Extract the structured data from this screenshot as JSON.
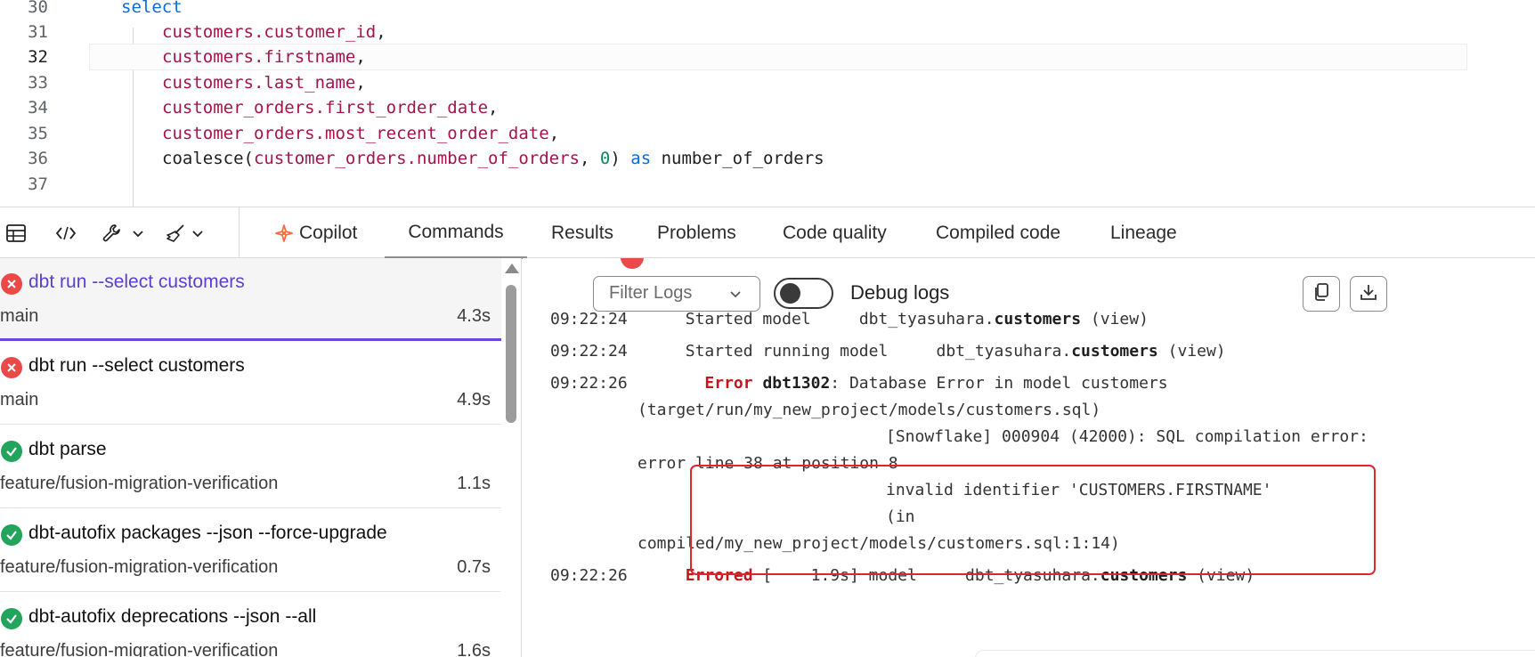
{
  "editor": {
    "lines": [
      {
        "n": "30",
        "kind": "select",
        "text": "select"
      },
      {
        "n": "31",
        "kind": "ident",
        "text": "customers.customer_id",
        "suffix": ","
      },
      {
        "n": "32",
        "kind": "ident",
        "text": "customers.firstname",
        "suffix": ","
      },
      {
        "n": "33",
        "kind": "ident",
        "text": "customers.last_name",
        "suffix": ","
      },
      {
        "n": "34",
        "kind": "ident",
        "text": "customer_orders.first_order_date",
        "suffix": ","
      },
      {
        "n": "35",
        "kind": "ident",
        "text": "customer_orders.most_recent_order_date",
        "suffix": ","
      },
      {
        "n": "36",
        "kind": "coalesce",
        "fn": "coalesce(",
        "arg": "customer_orders.number_of_orders",
        "sep": ", ",
        "num": "0",
        "close": ")",
        "as": "as",
        "alias": "number_of_orders"
      },
      {
        "n": "37"
      }
    ],
    "current_line": "32"
  },
  "toolbar": {
    "icons": [
      "table-icon",
      "code-icon",
      "wrench-icon",
      "chevron-down-icon",
      "broom-icon",
      "chevron-down-icon"
    ],
    "tabs": [
      {
        "label": "Copilot",
        "icon": "copilot-icon"
      },
      {
        "label": "Commands",
        "active": true
      },
      {
        "label": "Results"
      },
      {
        "label": "Problems"
      },
      {
        "label": "Code quality"
      },
      {
        "label": "Compiled code"
      },
      {
        "label": "Lineage"
      }
    ]
  },
  "commands": [
    {
      "title": "dbt run --select customers",
      "branch": "main",
      "duration": "4.3s",
      "status": "error",
      "selected": true
    },
    {
      "title": "dbt run --select customers",
      "branch": "main",
      "duration": "4.9s",
      "status": "error"
    },
    {
      "title": "dbt parse",
      "branch": "feature/fusion-migration-verification",
      "duration": "1.1s",
      "status": "success"
    },
    {
      "title": "dbt-autofix packages --json --force-upgrade",
      "branch": "feature/fusion-migration-verification",
      "duration": "0.7s",
      "status": "success"
    },
    {
      "title": "dbt-autofix deprecations --json --all",
      "branch": "feature/fusion-migration-verification",
      "duration": "1.6s",
      "status": "success"
    }
  ],
  "logs": {
    "filter_placeholder": "Filter Logs",
    "debug_label": "Debug logs",
    "debug_enabled": false,
    "copy_icon": "copy-icon",
    "download_icon": "download-icon",
    "lines": {
      "l1_time": "09:22:24",
      "l1_msg": "Started model",
      "l1_schema": "dbt_tyasuhara.",
      "l1_model": "customers",
      "l1_type": " (view)",
      "l2_time": "09:22:24",
      "l2_msg": "Started running model",
      "l2_schema": "dbt_tyasuhara.",
      "l2_model": "customers",
      "l2_type": " (view)",
      "l3_time": "09:22:26",
      "l3_level": "Error",
      "l3_code": "dbt1302",
      "l3_msg": ": Database Error in model customers",
      "l4": "(target/run/my_new_project/models/customers.sql)",
      "l5": "[Snowflake] 000904 (42000): SQL compilation error:",
      "l6": "error line 38 at position 8",
      "l7": "invalid identifier 'CUSTOMERS.FIRSTNAME'",
      "l8": "(in",
      "l9": "compiled/my_new_project/models/customers.sql:1:14)",
      "l10_time": "09:22:26",
      "l10_level": "Errored",
      "l10_bracket": " [",
      "l10_dur": "    1.9s",
      "l10_rest": "] model",
      "l10_schema": "dbt_tyasuhara.",
      "l10_model": "customers",
      "l10_type": " (view)"
    }
  },
  "colors": {
    "accent": "#6a48d7",
    "error": "#ea4a47",
    "success": "#22a45c",
    "keyword": "#0d6bd6",
    "identifier": "#a3154a"
  }
}
